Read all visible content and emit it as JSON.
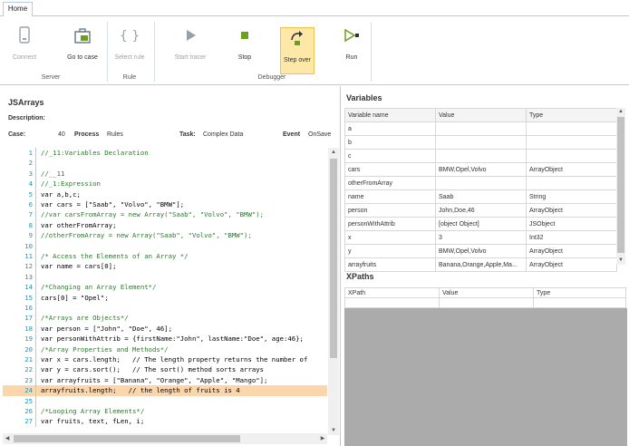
{
  "ribbon": {
    "tab_home": "Home",
    "buttons": {
      "connect": "Connect",
      "goto_case": "Go to case",
      "select_rule": "Select rule",
      "start_tracer": "Start tracer",
      "stop": "Stop",
      "step_over": "Step over",
      "run": "Run"
    },
    "groups": {
      "server": "Server",
      "rule": "Rule",
      "debugger": "Debugger"
    }
  },
  "left": {
    "title": "JSArrays",
    "description_label": "Description:",
    "case_label": "Case:",
    "case_value": "40",
    "process_label": "Process",
    "process_value": "Rules",
    "task_label": "Task:",
    "task_value": "Complex Data",
    "event_label": "Event",
    "event_value": "OnSave"
  },
  "code": {
    "highlighted_line": 24,
    "lines": [
      {
        "n": "1",
        "t": "//_11:Variables Declaration"
      },
      {
        "n": "2",
        "t": ""
      },
      {
        "n": "3",
        "t": "//__11"
      },
      {
        "n": "4",
        "t": "//_1:Expression"
      },
      {
        "n": "5",
        "t": "var a,b,c;"
      },
      {
        "n": "6",
        "t": "var cars = [\"Saab\", \"Volvo\", \"BMW\"];"
      },
      {
        "n": "7",
        "t": "//var carsFromArray = new Array(\"Saab\", \"Volvo\", \"BMW\");"
      },
      {
        "n": "8",
        "t": "var otherFromArray;"
      },
      {
        "n": "9",
        "t": "//otherFromArray = new Array(\"Saab\", \"Volvo\", \"BMW\");"
      },
      {
        "n": "10",
        "t": ""
      },
      {
        "n": "11",
        "t": "/* Access the Elements of an Array */"
      },
      {
        "n": "12",
        "t": "var name = cars[0];"
      },
      {
        "n": "13",
        "t": ""
      },
      {
        "n": "14",
        "t": "/*Changing an Array Element*/"
      },
      {
        "n": "15",
        "t": "cars[0] = \"Opel\";"
      },
      {
        "n": "16",
        "t": ""
      },
      {
        "n": "17",
        "t": "/*Arrays are Objects*/"
      },
      {
        "n": "18",
        "t": "var person = [\"John\", \"Doe\", 46];"
      },
      {
        "n": "19",
        "t": "var personWithAttrib = {firstName:\"John\", lastName:\"Doe\", age:46};"
      },
      {
        "n": "20",
        "t": "/*Array Properties and Methods*/"
      },
      {
        "n": "21",
        "t": "var x = cars.length;   // The length property returns the number of"
      },
      {
        "n": "22",
        "t": "var y = cars.sort();   // The sort() method sorts arrays"
      },
      {
        "n": "23",
        "t": "var arrayfruits = [\"Banana\", \"Orange\", \"Apple\", \"Mango\"];"
      },
      {
        "n": "24",
        "t": "arrayfruits.length;   // the length of fruits is 4"
      },
      {
        "n": "25",
        "t": ""
      },
      {
        "n": "26",
        "t": "/*Looping Array Elements*/"
      },
      {
        "n": "27",
        "t": "var fruits, text, fLen, i;"
      }
    ]
  },
  "variables": {
    "title": "Variables",
    "columns": [
      "Variable name",
      "Value",
      "Type"
    ],
    "rows": [
      [
        "a",
        "",
        ""
      ],
      [
        "b",
        "",
        ""
      ],
      [
        "c",
        "",
        ""
      ],
      [
        "cars",
        "BMW,Opel,Volvo",
        "ArrayObject"
      ],
      [
        "otherFromArray",
        "",
        ""
      ],
      [
        "name",
        "Saab",
        "String"
      ],
      [
        "person",
        "John,Doe,46",
        "ArrayObject"
      ],
      [
        "personWithAttrib",
        "[object Object]",
        "JSObject"
      ],
      [
        "x",
        "3",
        "Int32"
      ],
      [
        "y",
        "BMW,Opel,Volvo",
        "ArrayObject"
      ],
      [
        "arrayfruits",
        "Banana,Orange,Apple,Ma...",
        "ArrayObject"
      ]
    ]
  },
  "xpaths": {
    "title": "XPaths",
    "columns": [
      "XPath",
      "Value",
      "Type"
    ]
  },
  "colors": {
    "highlight": "#fbd6ad",
    "stop_green": "#6aa020",
    "hover": "#fde8a8"
  }
}
